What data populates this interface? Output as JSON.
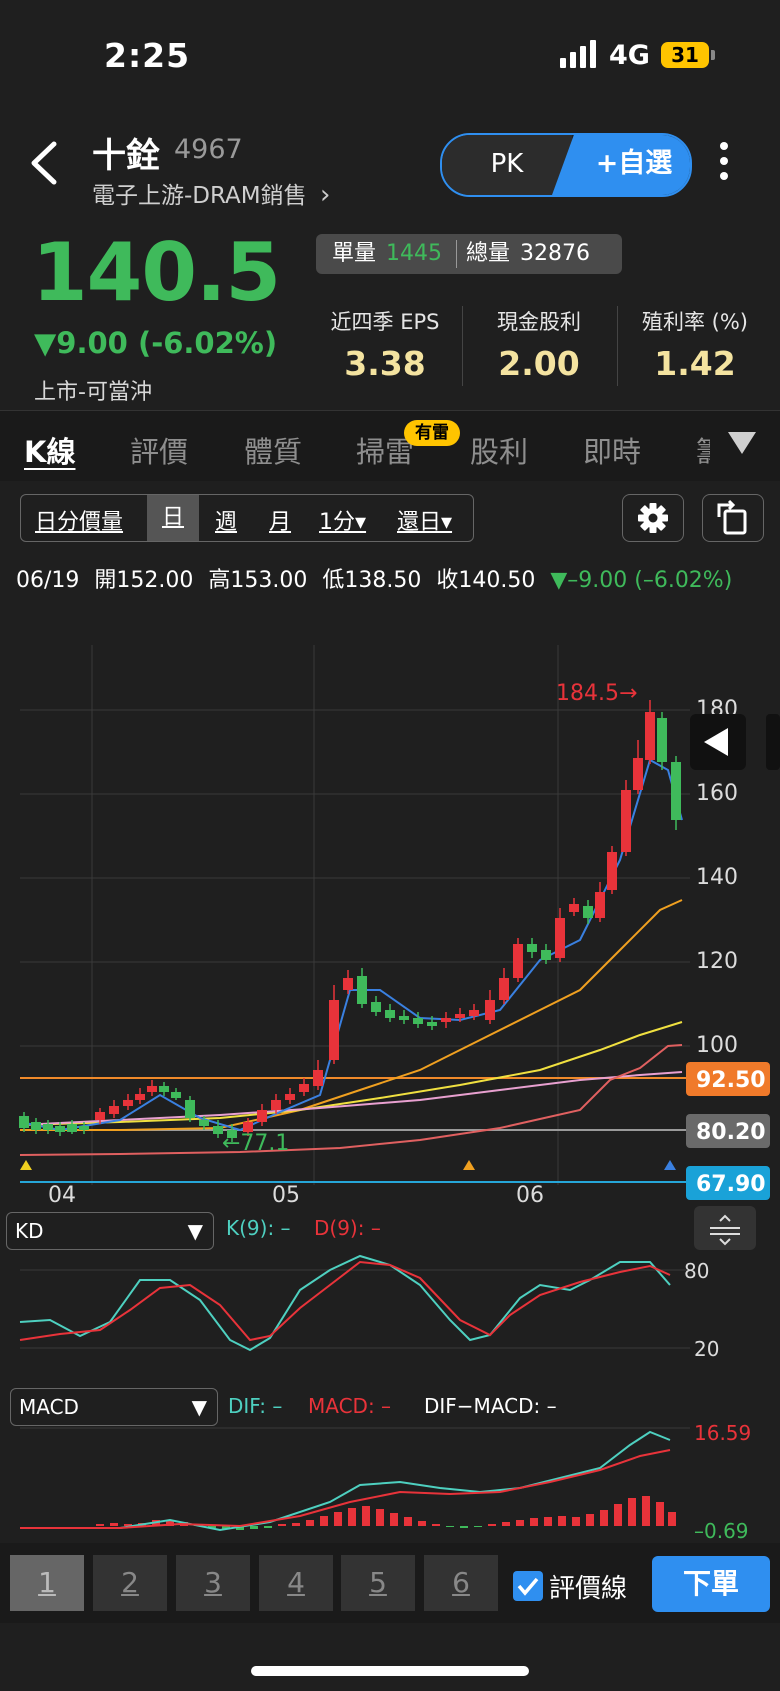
{
  "status": {
    "time": "2:25",
    "network": "4G",
    "battery": "31"
  },
  "stock": {
    "name": "十銓",
    "code": "4967",
    "category": "電子上游-DRAM銷售",
    "price": "140.5",
    "change": "▼9.00 (-6.02%)",
    "market": "上市-可當沖"
  },
  "header": {
    "pk_label": "PK",
    "add_label": "+自選"
  },
  "volume": {
    "single_label": "單量",
    "single_value": "1445",
    "total_label": "總量",
    "total_value": "32876"
  },
  "stats": [
    {
      "label": "近四季 EPS",
      "value": "3.38"
    },
    {
      "label": "現金股利",
      "value": "2.00"
    },
    {
      "label": "殖利率 (%)",
      "value": "1.42"
    }
  ],
  "tabs": [
    "K線",
    "評價",
    "體質",
    "掃雷",
    "股利",
    "即時",
    "籌"
  ],
  "tab_badge": "有雷",
  "k_toolbar": [
    "日分價量",
    "日",
    "週",
    "月",
    "1分▾",
    "還日▾"
  ],
  "ohlc": {
    "date": "06/19",
    "open": "開152.00",
    "high": "高153.00",
    "low": "低138.50",
    "close": "收140.50",
    "change": "▼–9.00 (–6.02%)"
  },
  "chart_labels": {
    "high_mark": "184.5→",
    "low_mark": "←77.1",
    "y_ticks": [
      "180",
      "160",
      "140",
      "120",
      "100"
    ],
    "x_ticks": [
      "04",
      "05",
      "06"
    ],
    "price_tags": [
      "92.50",
      "80.20",
      "67.90"
    ],
    "kd_select": "KD",
    "kd_k": "K(9): –",
    "kd_d": "D(9): –",
    "kd_ticks": [
      "80",
      "20"
    ],
    "macd_select": "MACD",
    "macd_dif": "DIF: –",
    "macd_macd": "MACD: –",
    "macd_diff": "DIF−MACD: –",
    "macd_ticks": [
      "16.59",
      "–0.69"
    ]
  },
  "bottom": {
    "pages": [
      "1",
      "2",
      "3",
      "4",
      "5",
      "6"
    ],
    "valuation_label": "評價線",
    "order_label": "下單"
  },
  "colors": {
    "up": "#e8333a",
    "down": "#3fba5b",
    "accent": "#2f8ff0",
    "highlight": "#f4e3a0"
  }
}
